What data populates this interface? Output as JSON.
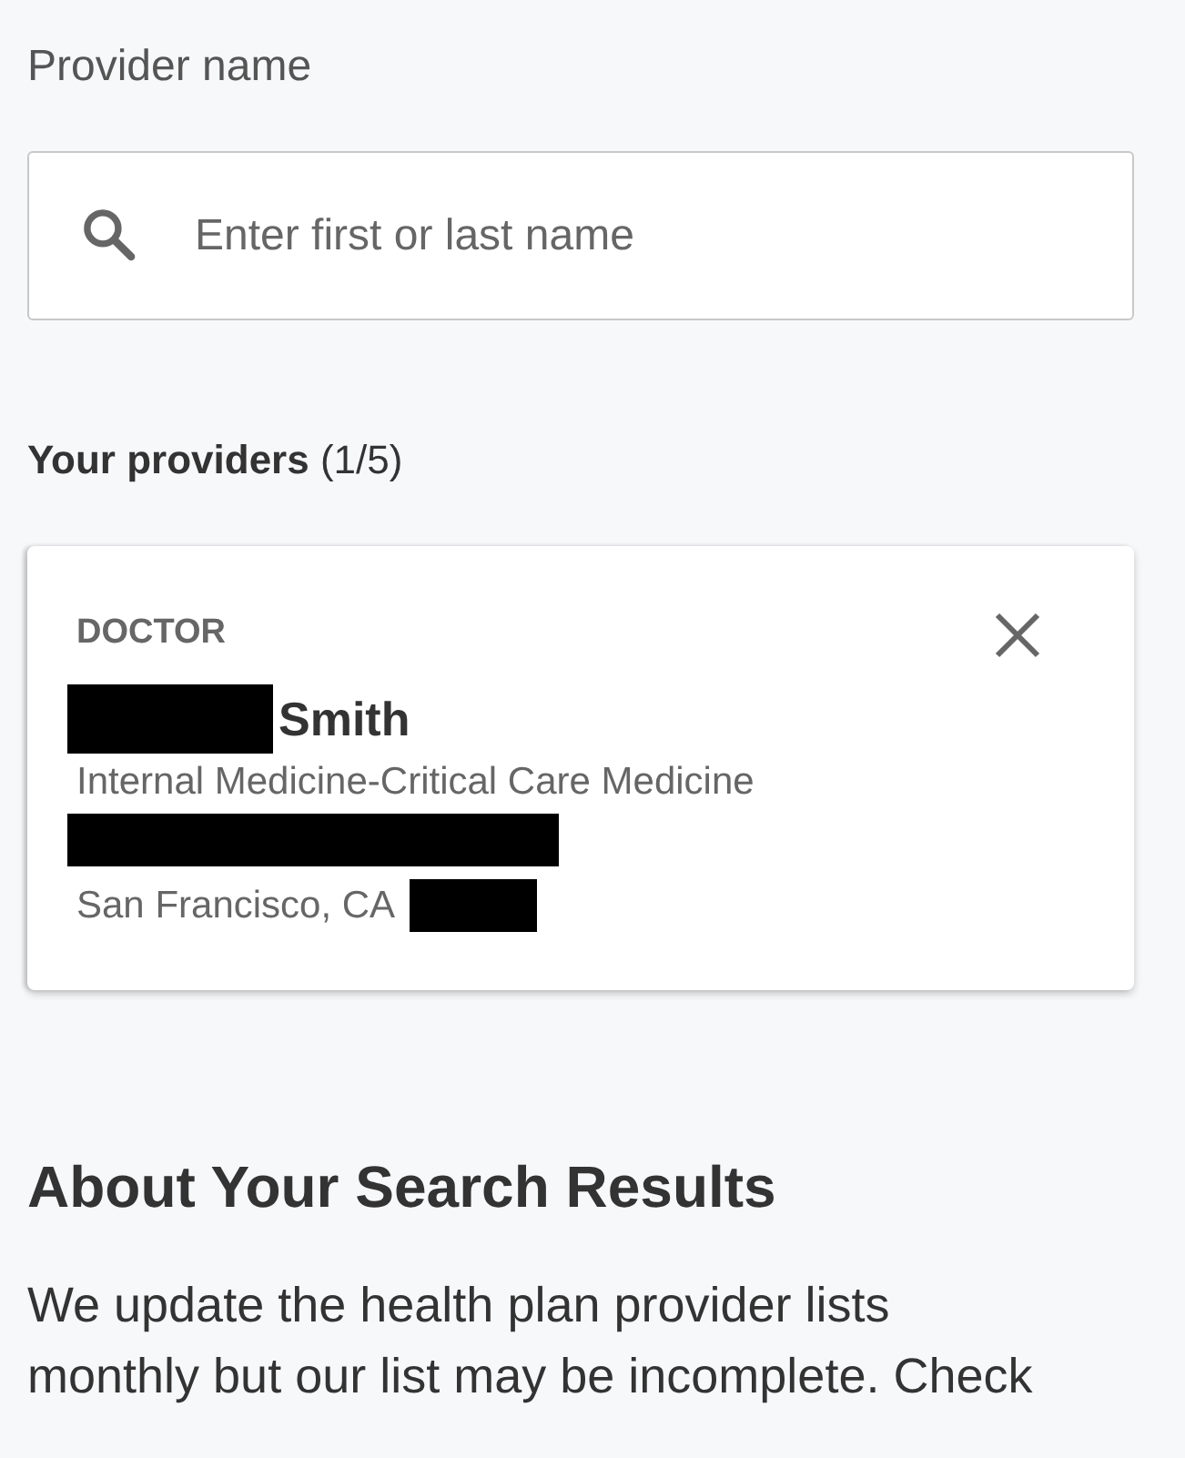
{
  "search": {
    "label": "Provider name",
    "placeholder": "Enter first or last name"
  },
  "providers": {
    "heading": "**Your providers** (1/5)",
    "items": [
      {
        "type": "DOCTOR",
        "name": "Smith",
        "specialty": "Internal Medicine-Critical Care Medicine",
        "city": "San Francisco, CA"
      }
    ]
  },
  "about": {
    "heading": "About Your Search Results",
    "text": "We update the health plan provider lists monthly but our list may be incomplete. Check"
  }
}
